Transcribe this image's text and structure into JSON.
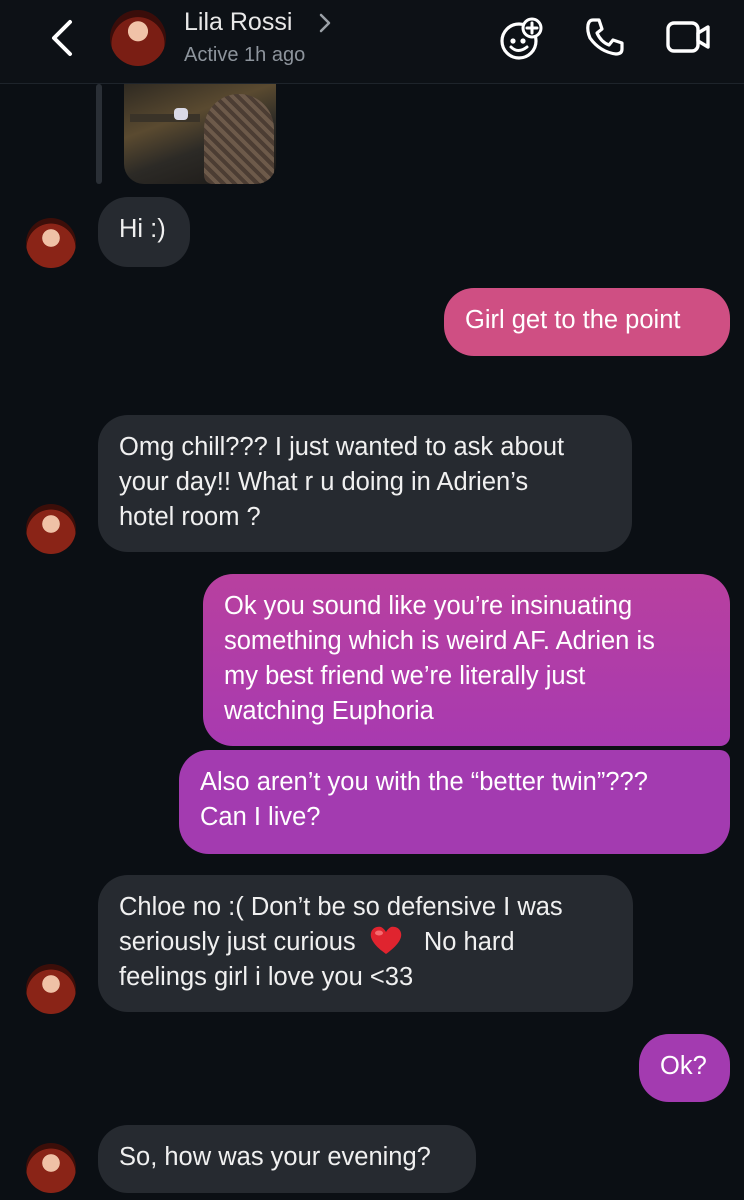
{
  "header": {
    "contact_name": "Lila Rossi",
    "status": "Active 1h ago",
    "icons": [
      "back-icon",
      "chevron-right-icon",
      "effects-icon",
      "phone-icon",
      "video-icon"
    ]
  },
  "colors": {
    "background": "#0b0f14",
    "received_bubble": "#262a30",
    "sent_gradient_top": "#d4537e",
    "sent_gradient_bottom": "#a13ab0"
  },
  "messages": [
    {
      "from": "other",
      "text": "Hi :)"
    },
    {
      "from": "me",
      "text": "Girl get to the point"
    },
    {
      "from": "other",
      "lines": [
        "Omg chill??? I just wanted to ask about",
        "your day!! What r u doing in Adrien’s",
        "hotel room ?"
      ]
    },
    {
      "from": "me",
      "lines": [
        "Ok you sound like you’re insinuating",
        "something which is weird AF. Adrien is",
        "my best friend we’re literally just",
        "watching Euphoria"
      ]
    },
    {
      "from": "me",
      "lines": [
        "Also aren’t you with the “better twin”???",
        "Can I live?"
      ]
    },
    {
      "from": "other",
      "lines": [
        "Chloe no :( Don’t be so defensive I was",
        "seriously just curious",
        "No hard",
        "feelings girl i love you <33"
      ]
    },
    {
      "from": "me",
      "text": "Ok?"
    },
    {
      "from": "other",
      "text": "So, how was your evening?"
    }
  ]
}
